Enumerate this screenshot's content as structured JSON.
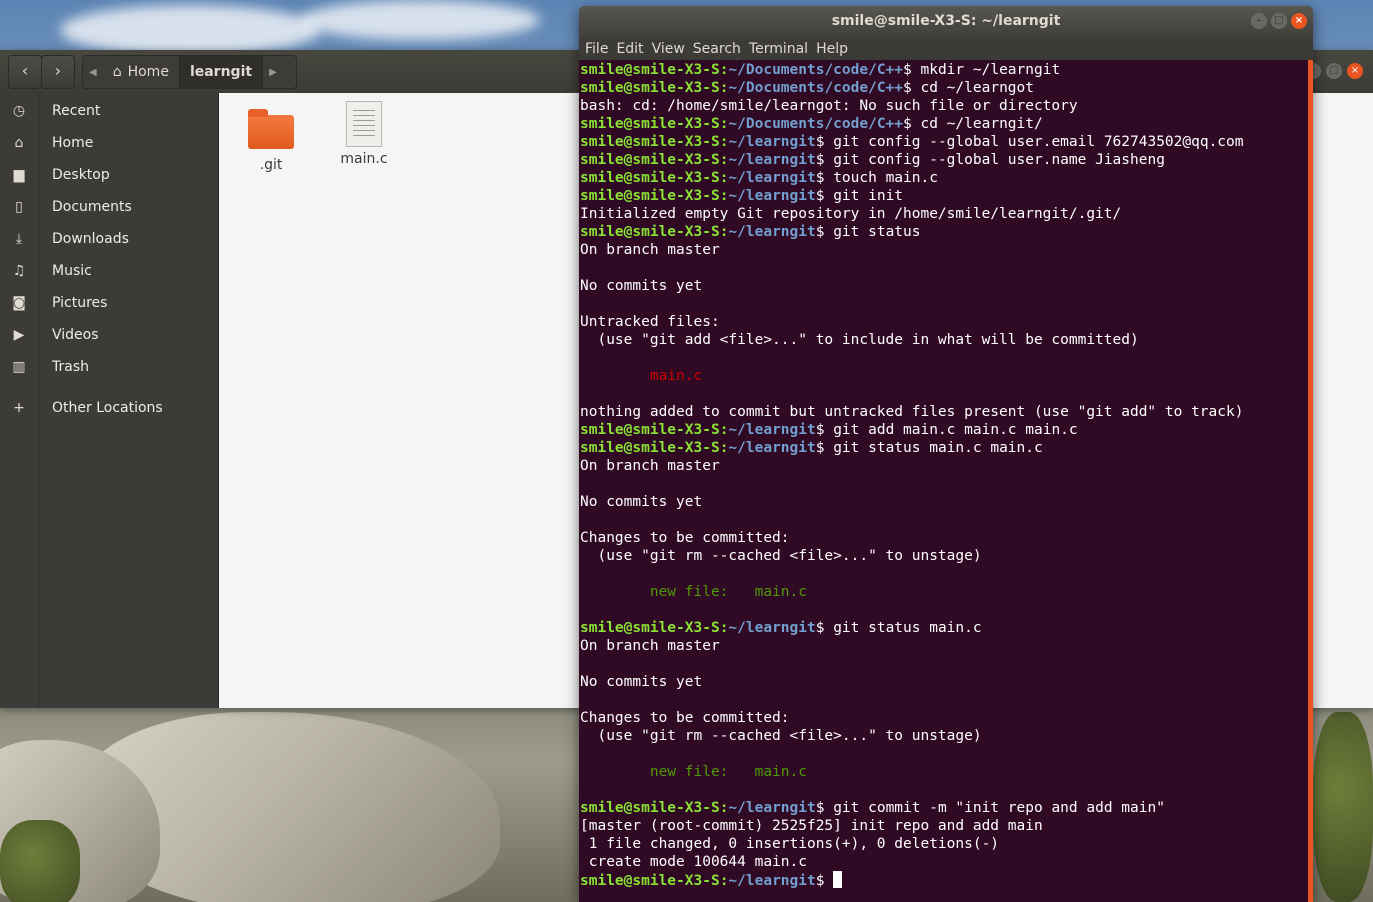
{
  "files": {
    "path": {
      "home_label": "Home",
      "current_label": "learngit"
    },
    "sidebar": [
      {
        "icon": "clock-icon",
        "glyph": "◷",
        "label": "Recent"
      },
      {
        "icon": "home-icon",
        "glyph": "⌂",
        "label": "Home"
      },
      {
        "icon": "folder-icon",
        "glyph": "▆",
        "label": "Desktop"
      },
      {
        "icon": "document-icon",
        "glyph": "▯",
        "label": "Documents"
      },
      {
        "icon": "download-icon",
        "glyph": "⤓",
        "label": "Downloads"
      },
      {
        "icon": "music-icon",
        "glyph": "♫",
        "label": "Music"
      },
      {
        "icon": "camera-icon",
        "glyph": "◙",
        "label": "Pictures"
      },
      {
        "icon": "video-icon",
        "glyph": "▶",
        "label": "Videos"
      },
      {
        "icon": "trash-icon",
        "glyph": "▥",
        "label": "Trash"
      },
      {
        "icon": "plus-icon",
        "glyph": "+",
        "label": "Other Locations"
      }
    ],
    "items": [
      {
        "name": ".git",
        "type": "folder"
      },
      {
        "name": "main.c",
        "type": "text-file"
      }
    ]
  },
  "terminal": {
    "title": "smile@smile-X3-S: ~/learngit",
    "menu": [
      "File",
      "Edit",
      "View",
      "Search",
      "Terminal",
      "Help"
    ],
    "lines": [
      {
        "user": "smile@smile-X3-S",
        "path": "~/Documents/code/C++",
        "cmd": " mkdir ~/learngit"
      },
      {
        "user": "smile@smile-X3-S",
        "path": "~/Documents/code/C++",
        "cmd": " cd ~/learngot"
      },
      {
        "text": "bash: cd: /home/smile/learngot: No such file or directory"
      },
      {
        "user": "smile@smile-X3-S",
        "path": "~/Documents/code/C++",
        "cmd": " cd ~/learngit/"
      },
      {
        "user": "smile@smile-X3-S",
        "path": "~/learngit",
        "cmd": " git config --global user.email 762743502@qq.com"
      },
      {
        "user": "smile@smile-X3-S",
        "path": "~/learngit",
        "cmd": " git config --global user.name Jiasheng"
      },
      {
        "user": "smile@smile-X3-S",
        "path": "~/learngit",
        "cmd": " touch main.c"
      },
      {
        "user": "smile@smile-X3-S",
        "path": "~/learngit",
        "cmd": " git init"
      },
      {
        "text": "Initialized empty Git repository in /home/smile/learngit/.git/"
      },
      {
        "user": "smile@smile-X3-S",
        "path": "~/learngit",
        "cmd": " git status"
      },
      {
        "text": "On branch master"
      },
      {
        "text": ""
      },
      {
        "text": "No commits yet"
      },
      {
        "text": ""
      },
      {
        "text": "Untracked files:"
      },
      {
        "text": "  (use \"git add <file>...\" to include in what will be committed)"
      },
      {
        "text": ""
      },
      {
        "indent": "        ",
        "red": "main.c"
      },
      {
        "text": ""
      },
      {
        "text": "nothing added to commit but untracked files present (use \"git add\" to track)"
      },
      {
        "user": "smile@smile-X3-S",
        "path": "~/learngit",
        "cmd": " git add main.c main.c main.c"
      },
      {
        "user": "smile@smile-X3-S",
        "path": "~/learngit",
        "cmd": " git status main.c main.c"
      },
      {
        "text": "On branch master"
      },
      {
        "text": ""
      },
      {
        "text": "No commits yet"
      },
      {
        "text": ""
      },
      {
        "text": "Changes to be committed:"
      },
      {
        "text": "  (use \"git rm --cached <file>...\" to unstage)"
      },
      {
        "text": ""
      },
      {
        "indent": "        ",
        "green": "new file:   main.c"
      },
      {
        "text": ""
      },
      {
        "user": "smile@smile-X3-S",
        "path": "~/learngit",
        "cmd": " git status main.c"
      },
      {
        "text": "On branch master"
      },
      {
        "text": ""
      },
      {
        "text": "No commits yet"
      },
      {
        "text": ""
      },
      {
        "text": "Changes to be committed:"
      },
      {
        "text": "  (use \"git rm --cached <file>...\" to unstage)"
      },
      {
        "text": ""
      },
      {
        "indent": "        ",
        "green": "new file:   main.c"
      },
      {
        "text": ""
      },
      {
        "user": "smile@smile-X3-S",
        "path": "~/learngit",
        "cmd": " git commit -m \"init repo and add main\""
      },
      {
        "text": "[master (root-commit) 2525f25] init repo and add main"
      },
      {
        "text": " 1 file changed, 0 insertions(+), 0 deletions(-)"
      },
      {
        "text": " create mode 100644 main.c"
      },
      {
        "user": "smile@smile-X3-S",
        "path": "~/learngit",
        "cmd": " ",
        "cursor": true
      }
    ]
  },
  "colors": {
    "terminal_bg": "#300a24",
    "prompt_user": "#8ae234",
    "prompt_path": "#729fcf",
    "accent": "#e95420"
  }
}
